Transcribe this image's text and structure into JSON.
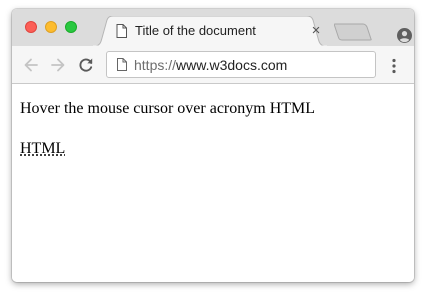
{
  "browser": {
    "tab_title": "Title of the document",
    "tab_close": "×",
    "url_scheme": "https://",
    "url_host": "www.w3docs.com"
  },
  "page": {
    "paragraph": "Hover the mouse cursor over acronym HTML",
    "abbreviation": "HTML"
  },
  "icons": {
    "window_controls": [
      "close-light",
      "minimize-light",
      "zoom-light"
    ],
    "toolbar": [
      "back-arrow-icon",
      "forward-arrow-icon",
      "reload-icon",
      "page-icon",
      "menu-dots-icon"
    ],
    "profile": "profile-icon"
  },
  "colors": {
    "tabbar_bg": "#dcdcdc",
    "toolbar_bg": "#f6f6f6",
    "close_light": "#fc5f57",
    "minimize_light": "#fdbc2e",
    "zoom_light": "#29c840"
  }
}
